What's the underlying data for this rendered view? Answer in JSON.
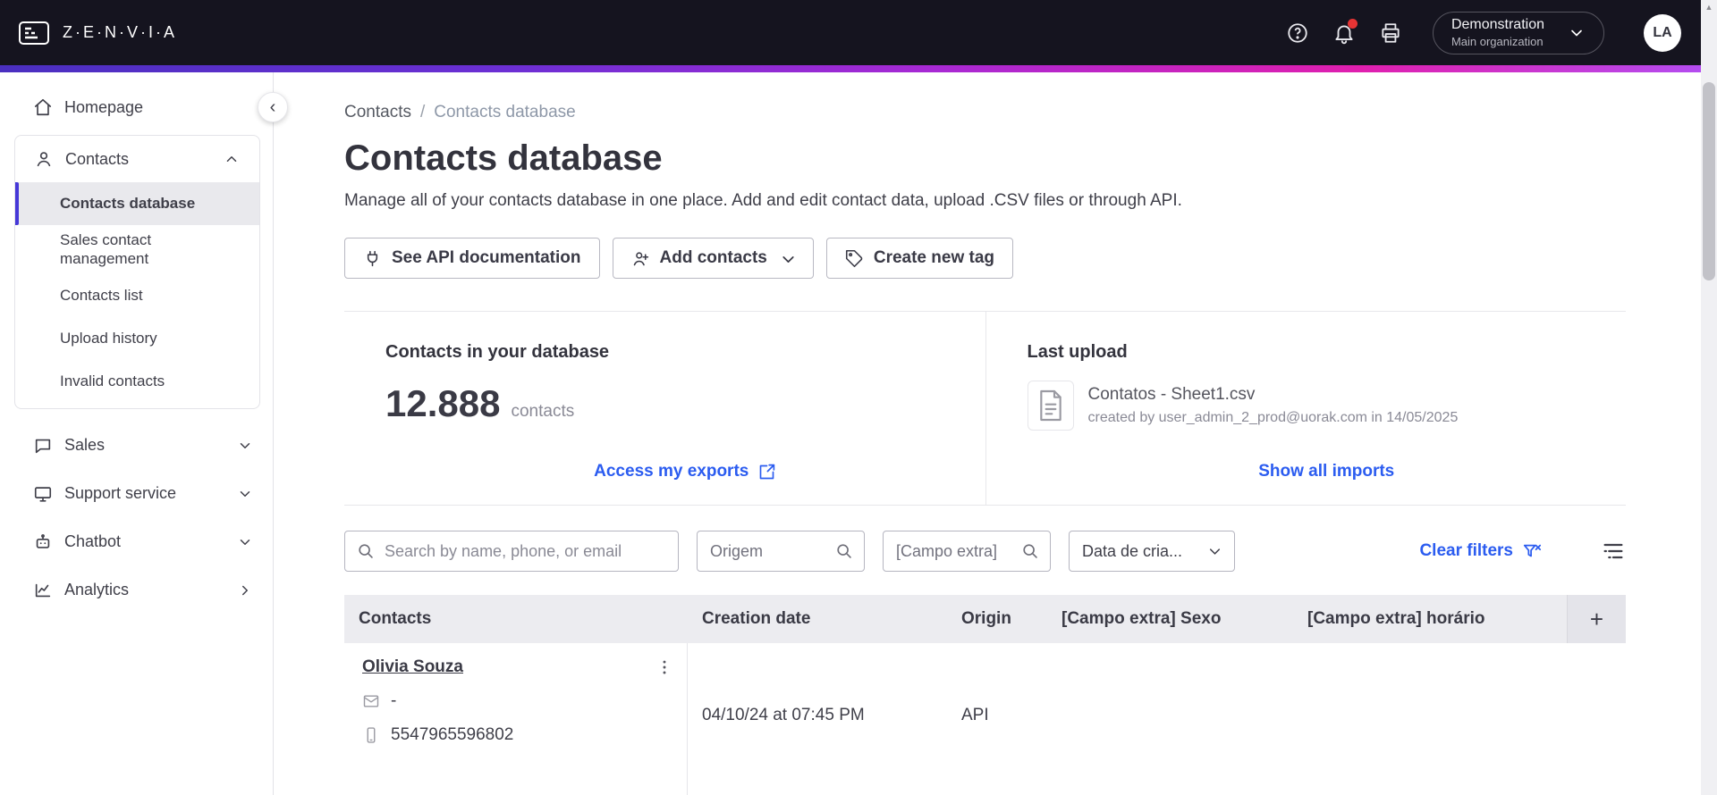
{
  "topbar": {
    "brand": "Z·E·N·V·I·A",
    "org_name": "Demonstration",
    "org_sub": "Main organization",
    "avatar": "LA"
  },
  "sidebar": {
    "homepage": "Homepage",
    "contacts": "Contacts",
    "contacts_children": [
      "Contacts database",
      "Sales contact management",
      "Contacts list",
      "Upload history",
      "Invalid contacts"
    ],
    "sales": "Sales",
    "support": "Support service",
    "chatbot": "Chatbot",
    "analytics": "Analytics"
  },
  "breadcrumb": {
    "root": "Contacts",
    "separator": "/",
    "current": "Contacts database"
  },
  "page": {
    "title": "Contacts database",
    "subtitle": "Manage all of your contacts database in one place. Add and edit contact data, upload .CSV files or through API."
  },
  "actions": {
    "api_docs": "See API documentation",
    "add_contacts": "Add contacts",
    "create_tag": "Create new tag"
  },
  "stats": {
    "database": {
      "title": "Contacts in your database",
      "count": "12.888",
      "unit": "contacts",
      "link": "Access my exports"
    },
    "upload": {
      "title": "Last upload",
      "file_name": "Contatos - Sheet1.csv",
      "meta": "created by user_admin_2_prod@uorak.com in 14/05/2025",
      "link": "Show all imports"
    }
  },
  "filters": {
    "search_placeholder": "Search by name, phone, or email",
    "origin_placeholder": "Origem",
    "extra_placeholder": "[Campo extra]",
    "date_label": "Data de cria...",
    "clear": "Clear filters"
  },
  "table": {
    "headers": {
      "contacts": "Contacts",
      "creation_date": "Creation date",
      "origin": "Origin",
      "extra_sexo": "[Campo extra] Sexo",
      "extra_horario": "[Campo extra] horário"
    },
    "add_column": "+",
    "rows": [
      {
        "name": "Olivia Souza",
        "email": "-",
        "phone": "5547965596802",
        "creation_date": "04/10/24 at 07:45 PM",
        "origin": "API",
        "sexo": "",
        "horario": ""
      }
    ]
  },
  "colors": {
    "topbar_bg": "#15141F",
    "accent_link": "#2B5CF0",
    "sidebar_accent": "#4638D8",
    "notification_dot": "#E63434",
    "gradient": [
      "#4A2FC0",
      "#6C2FD4",
      "#A829D4",
      "#E01FAE",
      "#B44CF0"
    ]
  }
}
